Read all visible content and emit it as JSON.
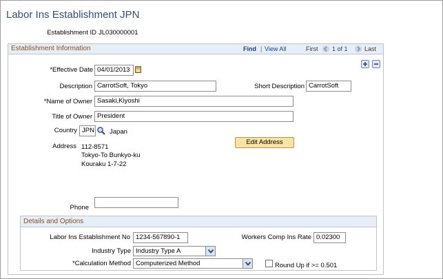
{
  "page": {
    "title": "Labor Ins Establishment JPN"
  },
  "establishment": {
    "label": "Establishment ID",
    "value": "JL030000001"
  },
  "sec1": {
    "title": "Establishment Information",
    "find": "Find",
    "separator": "|",
    "view_all": "View All",
    "first": "First",
    "counter": "1 of 1",
    "last": "Last",
    "add_icon": "plus-icon",
    "remove_icon": "minus-icon"
  },
  "effdate": {
    "label": "*Effective Date",
    "value": "04/01/2013",
    "icon": "calendar-icon"
  },
  "description": {
    "label": "Description",
    "value": "CarrotSoft, Tokyo"
  },
  "short_desc": {
    "label": "Short Description",
    "value": "CarrotSoft"
  },
  "owner_name": {
    "label": "*Name of Owner",
    "value": "Sasaki,Kiyoshi"
  },
  "owner_title": {
    "label": "Title of Owner",
    "value": "President"
  },
  "country": {
    "label": "Country",
    "value": "JPN",
    "name": "Japan",
    "icon": "lookup-icon"
  },
  "address": {
    "label": "Address",
    "lines": [
      "112-8571",
      "Tokyo-To Bunkyo-ku",
      "Kouraku 1-7-22"
    ],
    "edit_button": "Edit Address"
  },
  "phone": {
    "label": "Phone",
    "value": ""
  },
  "sec2": {
    "title": "Details and Options"
  },
  "labor_no": {
    "label": "Labor Ins Establishment No",
    "value": "1234-567890-1"
  },
  "workers_rate": {
    "label": "Workers Comp Ins Rate",
    "value": "0.02300"
  },
  "industry": {
    "label": "Industry Type",
    "value": "Industry Type A"
  },
  "calc": {
    "label": "*Calculation Method",
    "value": "Computerized Method"
  },
  "roundup": {
    "label": "Round Up if >= 0.501",
    "checked": false
  },
  "colors": {
    "title": "#2f4d7a",
    "section_title": "#8a4c1e",
    "section_bg": "#e6eef7",
    "button_bg": "#f9e3a2",
    "link": "#1f3f8a"
  }
}
